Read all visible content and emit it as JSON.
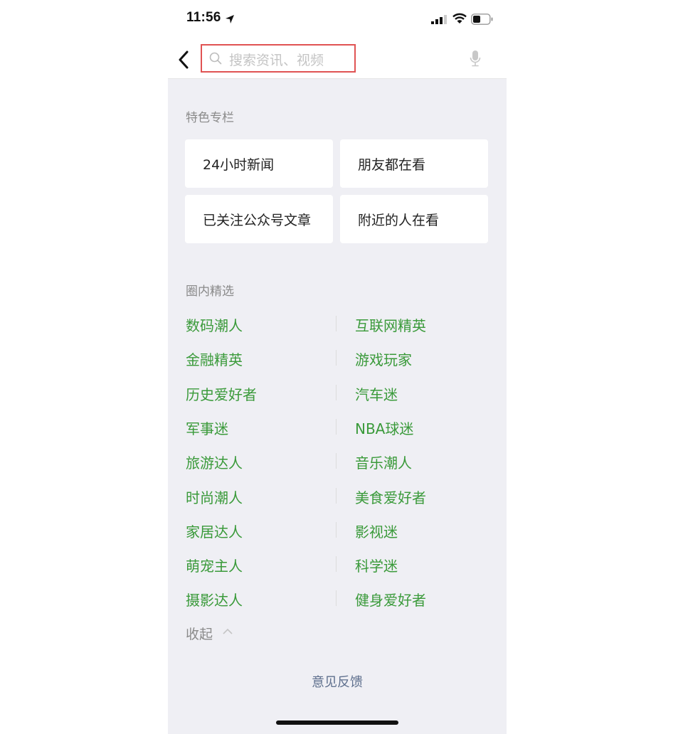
{
  "status_bar": {
    "time": "11:56"
  },
  "search": {
    "placeholder": "搜索资讯、视频"
  },
  "featured": {
    "title": "特色专栏",
    "cards": [
      "24小时新闻",
      "朋友都在看",
      "已关注公众号文章",
      "附近的人在看"
    ]
  },
  "circles": {
    "title": "圈内精选",
    "tags": [
      "数码潮人",
      "互联网精英",
      "金融精英",
      "游戏玩家",
      "历史爱好者",
      "汽车迷",
      "军事迷",
      "NBA球迷",
      "旅游达人",
      "音乐潮人",
      "时尚潮人",
      "美食爱好者",
      "家居达人",
      "影视迷",
      "萌宠主人",
      "科学迷",
      "摄影达人",
      "健身爱好者"
    ],
    "collapse_label": "收起"
  },
  "footer": {
    "feedback": "意见反馈"
  },
  "colors": {
    "accent_green": "#3a9a3a",
    "highlight_red": "#e05353",
    "background": "#efeff4",
    "link_blue": "#5e6f8d"
  }
}
